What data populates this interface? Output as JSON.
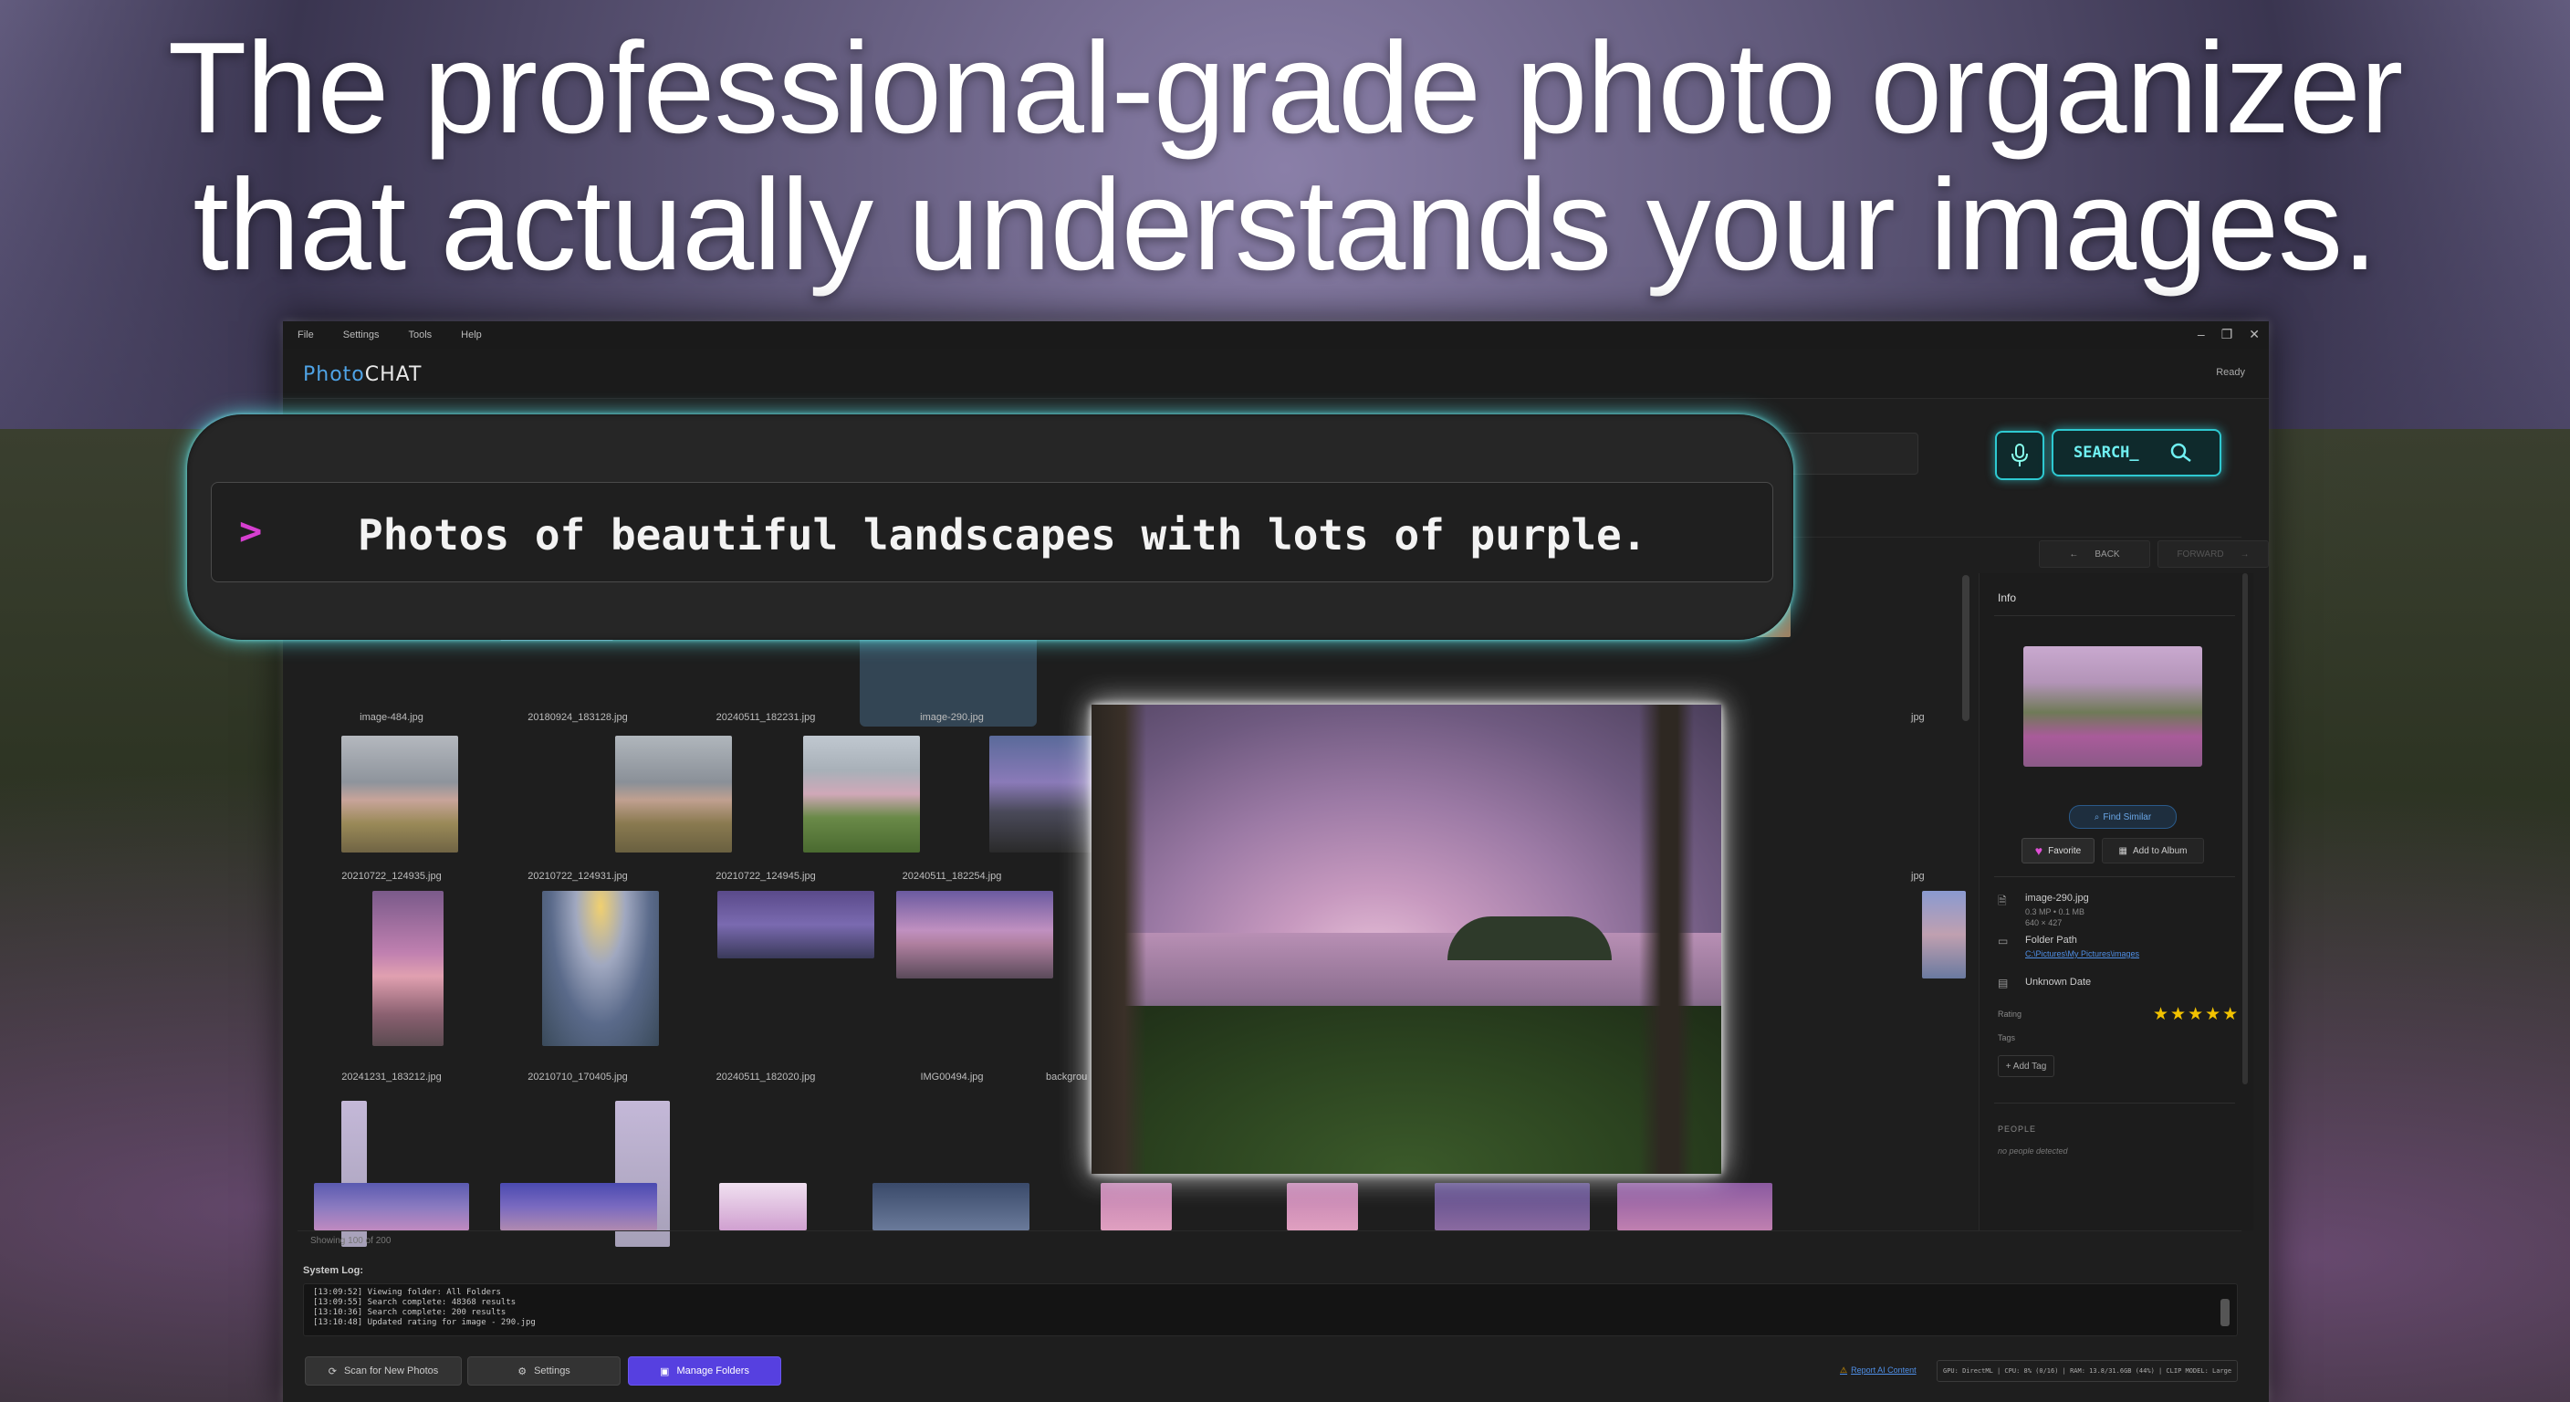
{
  "headline": {
    "line1": "The professional-grade photo organizer",
    "line2": "that actually understands your images."
  },
  "menu": [
    "File",
    "Settings",
    "Tools",
    "Help"
  ],
  "window_controls": [
    "–",
    "❐",
    "✕"
  ],
  "app": {
    "logo_part1": "Photo",
    "logo_part2": "CHAT",
    "status": "Ready"
  },
  "search": {
    "button_label": "SEARCH_",
    "mic_icon": "microphone-icon",
    "prompt_caret": ">",
    "prompt_text": "Photos of beautiful landscapes with lots of purple."
  },
  "nav": {
    "back": "BACK",
    "forward": "FORWARD"
  },
  "grid": {
    "row1_captions": [
      "image-484.jpg",
      "20180924_183128.jpg",
      "20240511_182231.jpg",
      "image-290.jpg"
    ],
    "row2_captions": [
      "20210722_124935.jpg",
      "20210722_124931.jpg",
      "20210722_124945.jpg",
      "20240511_182254.jpg"
    ],
    "row3_captions": [
      "20241231_183212.jpg",
      "20210710_170405.jpg",
      "20240511_182020.jpg",
      "IMG00494.jpg",
      "backgrou"
    ],
    "edge_caption": "jpg",
    "showing": "Showing 100 of 200"
  },
  "info": {
    "title": "Info",
    "find_similar": "Find Similar",
    "favorite": "Favorite",
    "add_to_album": "Add to Album",
    "filename": "image-290.jpg",
    "filesize": "0.3 MP • 0.1 MB",
    "dimensions": "640 × 427",
    "folder_label": "Folder Path",
    "folder_path": "C:\\Pictures\\My Pictures\\images",
    "date": "Unknown Date",
    "rating_label": "Rating",
    "rating": 5,
    "stars": "★★★★★",
    "tags_label": "Tags",
    "add_tag": "+ Add Tag",
    "people_label": "PEOPLE",
    "no_people": "no people detected"
  },
  "system_log": {
    "title": "System Log:",
    "lines": [
      "[13:09:52] Viewing folder: All Folders",
      "[13:09:55] Search complete: 48368 results",
      "[13:10:36] Search complete: 200 results",
      "[13:10:48] Updated rating for image - 290.jpg"
    ]
  },
  "bottom": {
    "scan": "Scan for New Photos",
    "settings": "Settings",
    "manage": "Manage Folders",
    "report": "Report AI Content",
    "status": "GPU: DirectML | CPU: 8% (0/16) | RAM: 13.8/31.6GB (44%) | CLIP MODEL: Large"
  },
  "colors": {
    "accent_cyan": "#2ec9d1",
    "accent_purple": "#5640e0",
    "caret_magenta": "#d63fd0",
    "star_gold": "#f2c200"
  }
}
